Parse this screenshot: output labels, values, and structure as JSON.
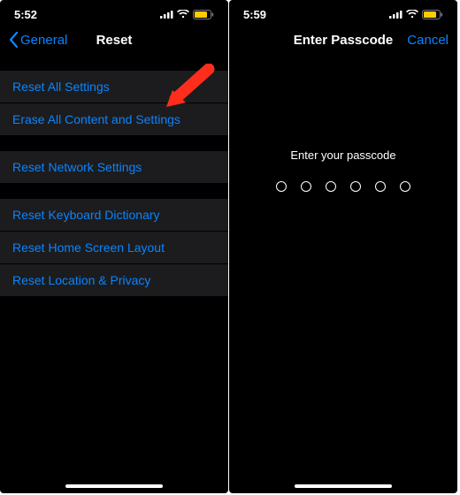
{
  "left": {
    "status": {
      "time": "5:52"
    },
    "nav": {
      "back": "General",
      "title": "Reset"
    },
    "groups": [
      {
        "items": [
          "Reset All Settings",
          "Erase All Content and Settings"
        ]
      },
      {
        "items": [
          "Reset Network Settings"
        ]
      },
      {
        "items": [
          "Reset Keyboard Dictionary",
          "Reset Home Screen Layout",
          "Reset Location & Privacy"
        ]
      }
    ]
  },
  "right": {
    "status": {
      "time": "5:59"
    },
    "nav": {
      "title": "Enter Passcode",
      "cancel": "Cancel"
    },
    "prompt": "Enter your passcode",
    "digits": 6
  },
  "colors": {
    "accent": "#0a84ff",
    "battery": "#ffcc00",
    "arrow": "#ff2d1c"
  }
}
